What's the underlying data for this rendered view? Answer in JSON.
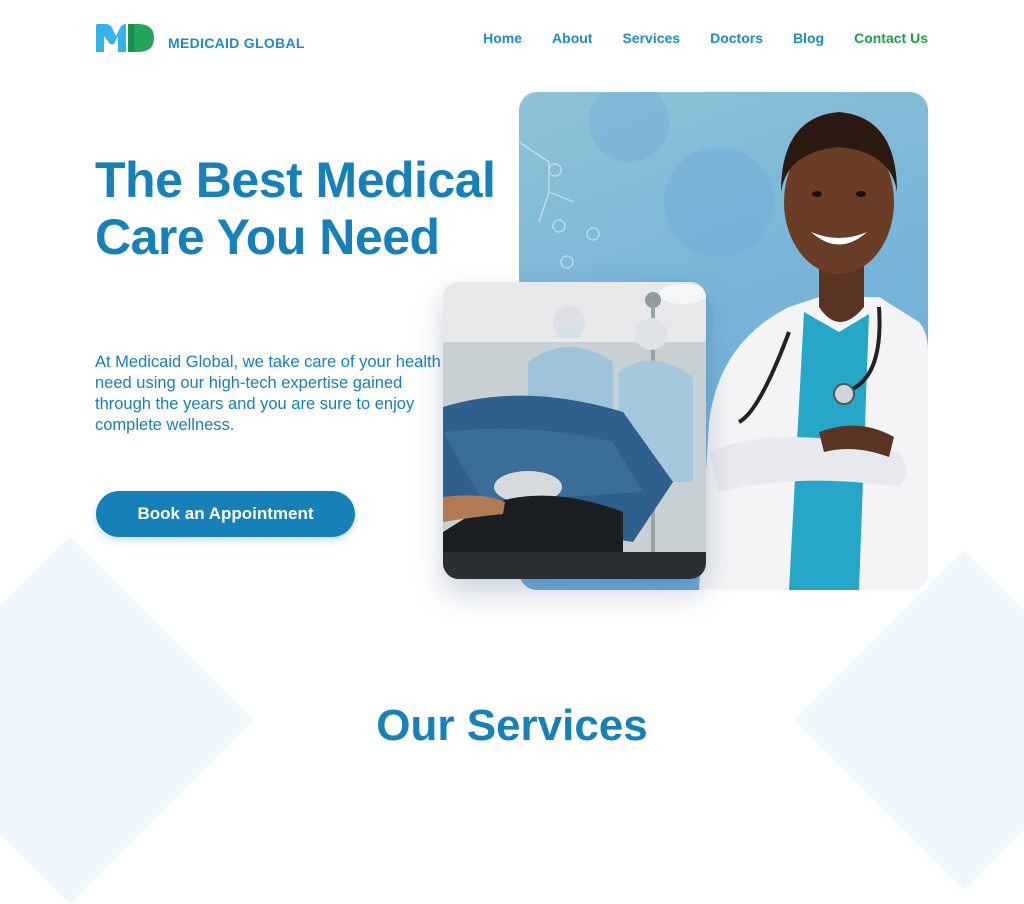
{
  "brand": {
    "name": "MEDICAID GLOBAL",
    "logo_icon": "md-logo-icon",
    "colors": {
      "primary": "#1680b8",
      "accent_green": "#1f9e4a",
      "light_blue": "#34b3e8"
    }
  },
  "nav": {
    "items": [
      {
        "label": "Home"
      },
      {
        "label": "About"
      },
      {
        "label": "Services"
      },
      {
        "label": "Doctors"
      },
      {
        "label": "Blog"
      },
      {
        "label": "Contact Us"
      }
    ]
  },
  "hero": {
    "title": "The Best Medical Care You Need",
    "description": "At Medicaid Global, we take care of your health need using our high-tech expertise gained through the years and you are sure to enjoy complete wellness.",
    "cta_label": "Book an Appointment"
  },
  "services": {
    "title": "Our Services"
  }
}
